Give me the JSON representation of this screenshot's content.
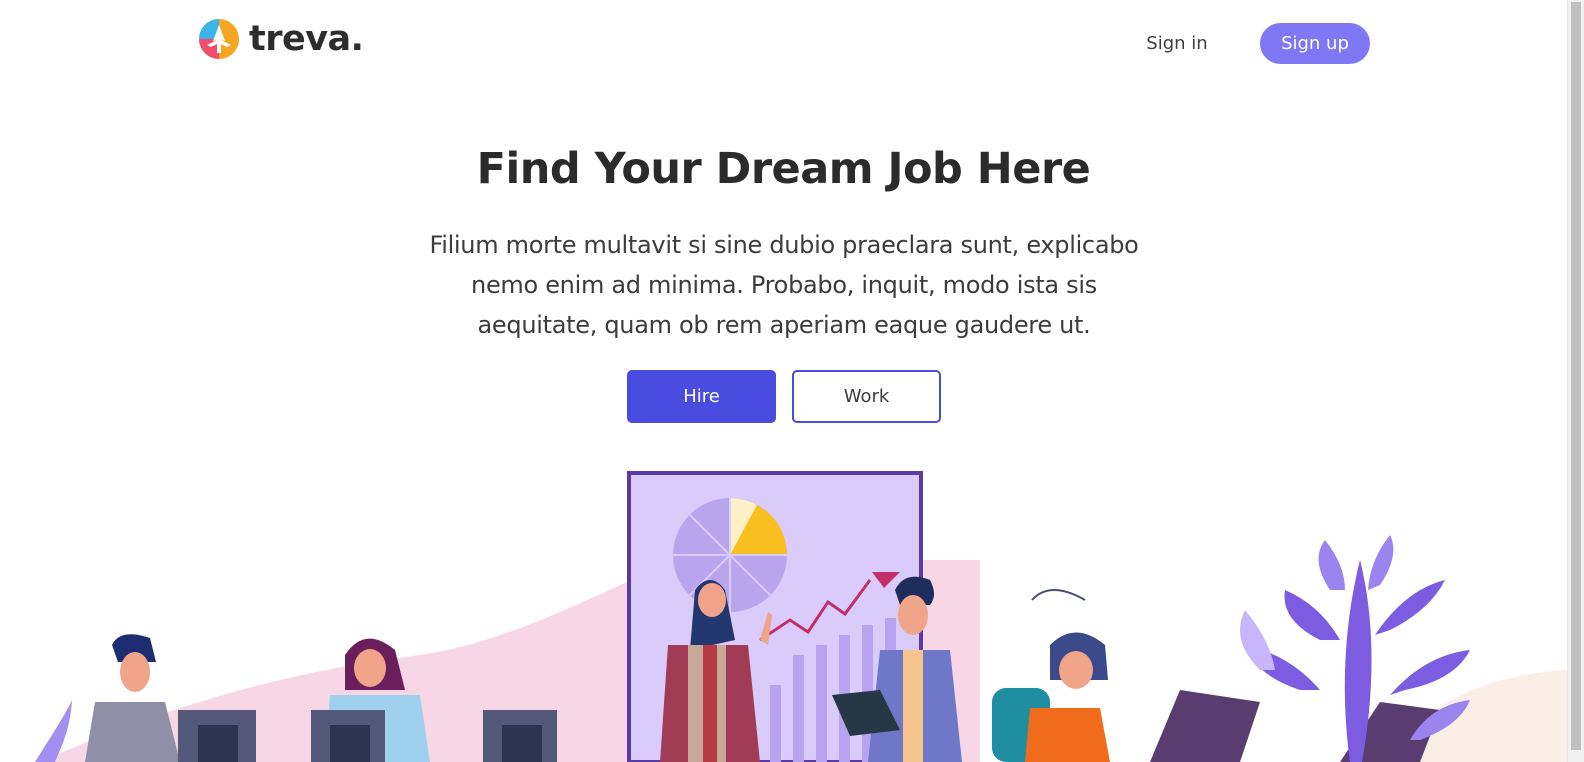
{
  "brand": {
    "name": "treva."
  },
  "nav": {
    "signin_label": "Sign in",
    "signup_label": "Sign up"
  },
  "hero": {
    "title": "Find Your Dream Job Here",
    "description_lines": [
      "Filium morte multavit si sine dubio praeclara sunt, explicabo",
      "nemo enim ad minima. Probabo, inquit, modo ista sis",
      "aequitate, quam ob rem aperiam eaque gaudere ut."
    ],
    "hire_label": "Hire",
    "work_label": "Work"
  },
  "colors": {
    "accent": "#4a4cdf",
    "signup": "#7e78f4",
    "illustration_purple": "#6b46c1",
    "illustration_pink": "#f7d6e6"
  },
  "icons": {
    "logo": "treva-logo-icon"
  }
}
